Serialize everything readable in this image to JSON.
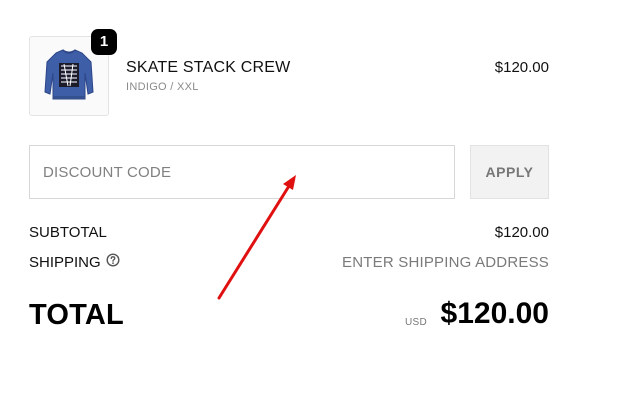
{
  "line_item": {
    "quantity": "1",
    "name": "SKATE STACK CREW",
    "variant": "INDIGO / XXL",
    "price": "$120.00",
    "thumbnail_icon": "sweatshirt-thumbnail",
    "thumbnail_color": "#3f5ea8"
  },
  "discount": {
    "placeholder": "DISCOUNT CODE",
    "value": "",
    "apply_label": "APPLY"
  },
  "summary": {
    "subtotal_label": "SUBTOTAL",
    "subtotal_value": "$120.00",
    "shipping_label": "SHIPPING",
    "shipping_help_icon": "question-circle-icon",
    "shipping_value": "ENTER SHIPPING ADDRESS"
  },
  "total": {
    "label": "TOTAL",
    "currency": "USD",
    "value": "$120.00"
  },
  "annotation": {
    "type": "arrow",
    "color": "#e01010"
  }
}
